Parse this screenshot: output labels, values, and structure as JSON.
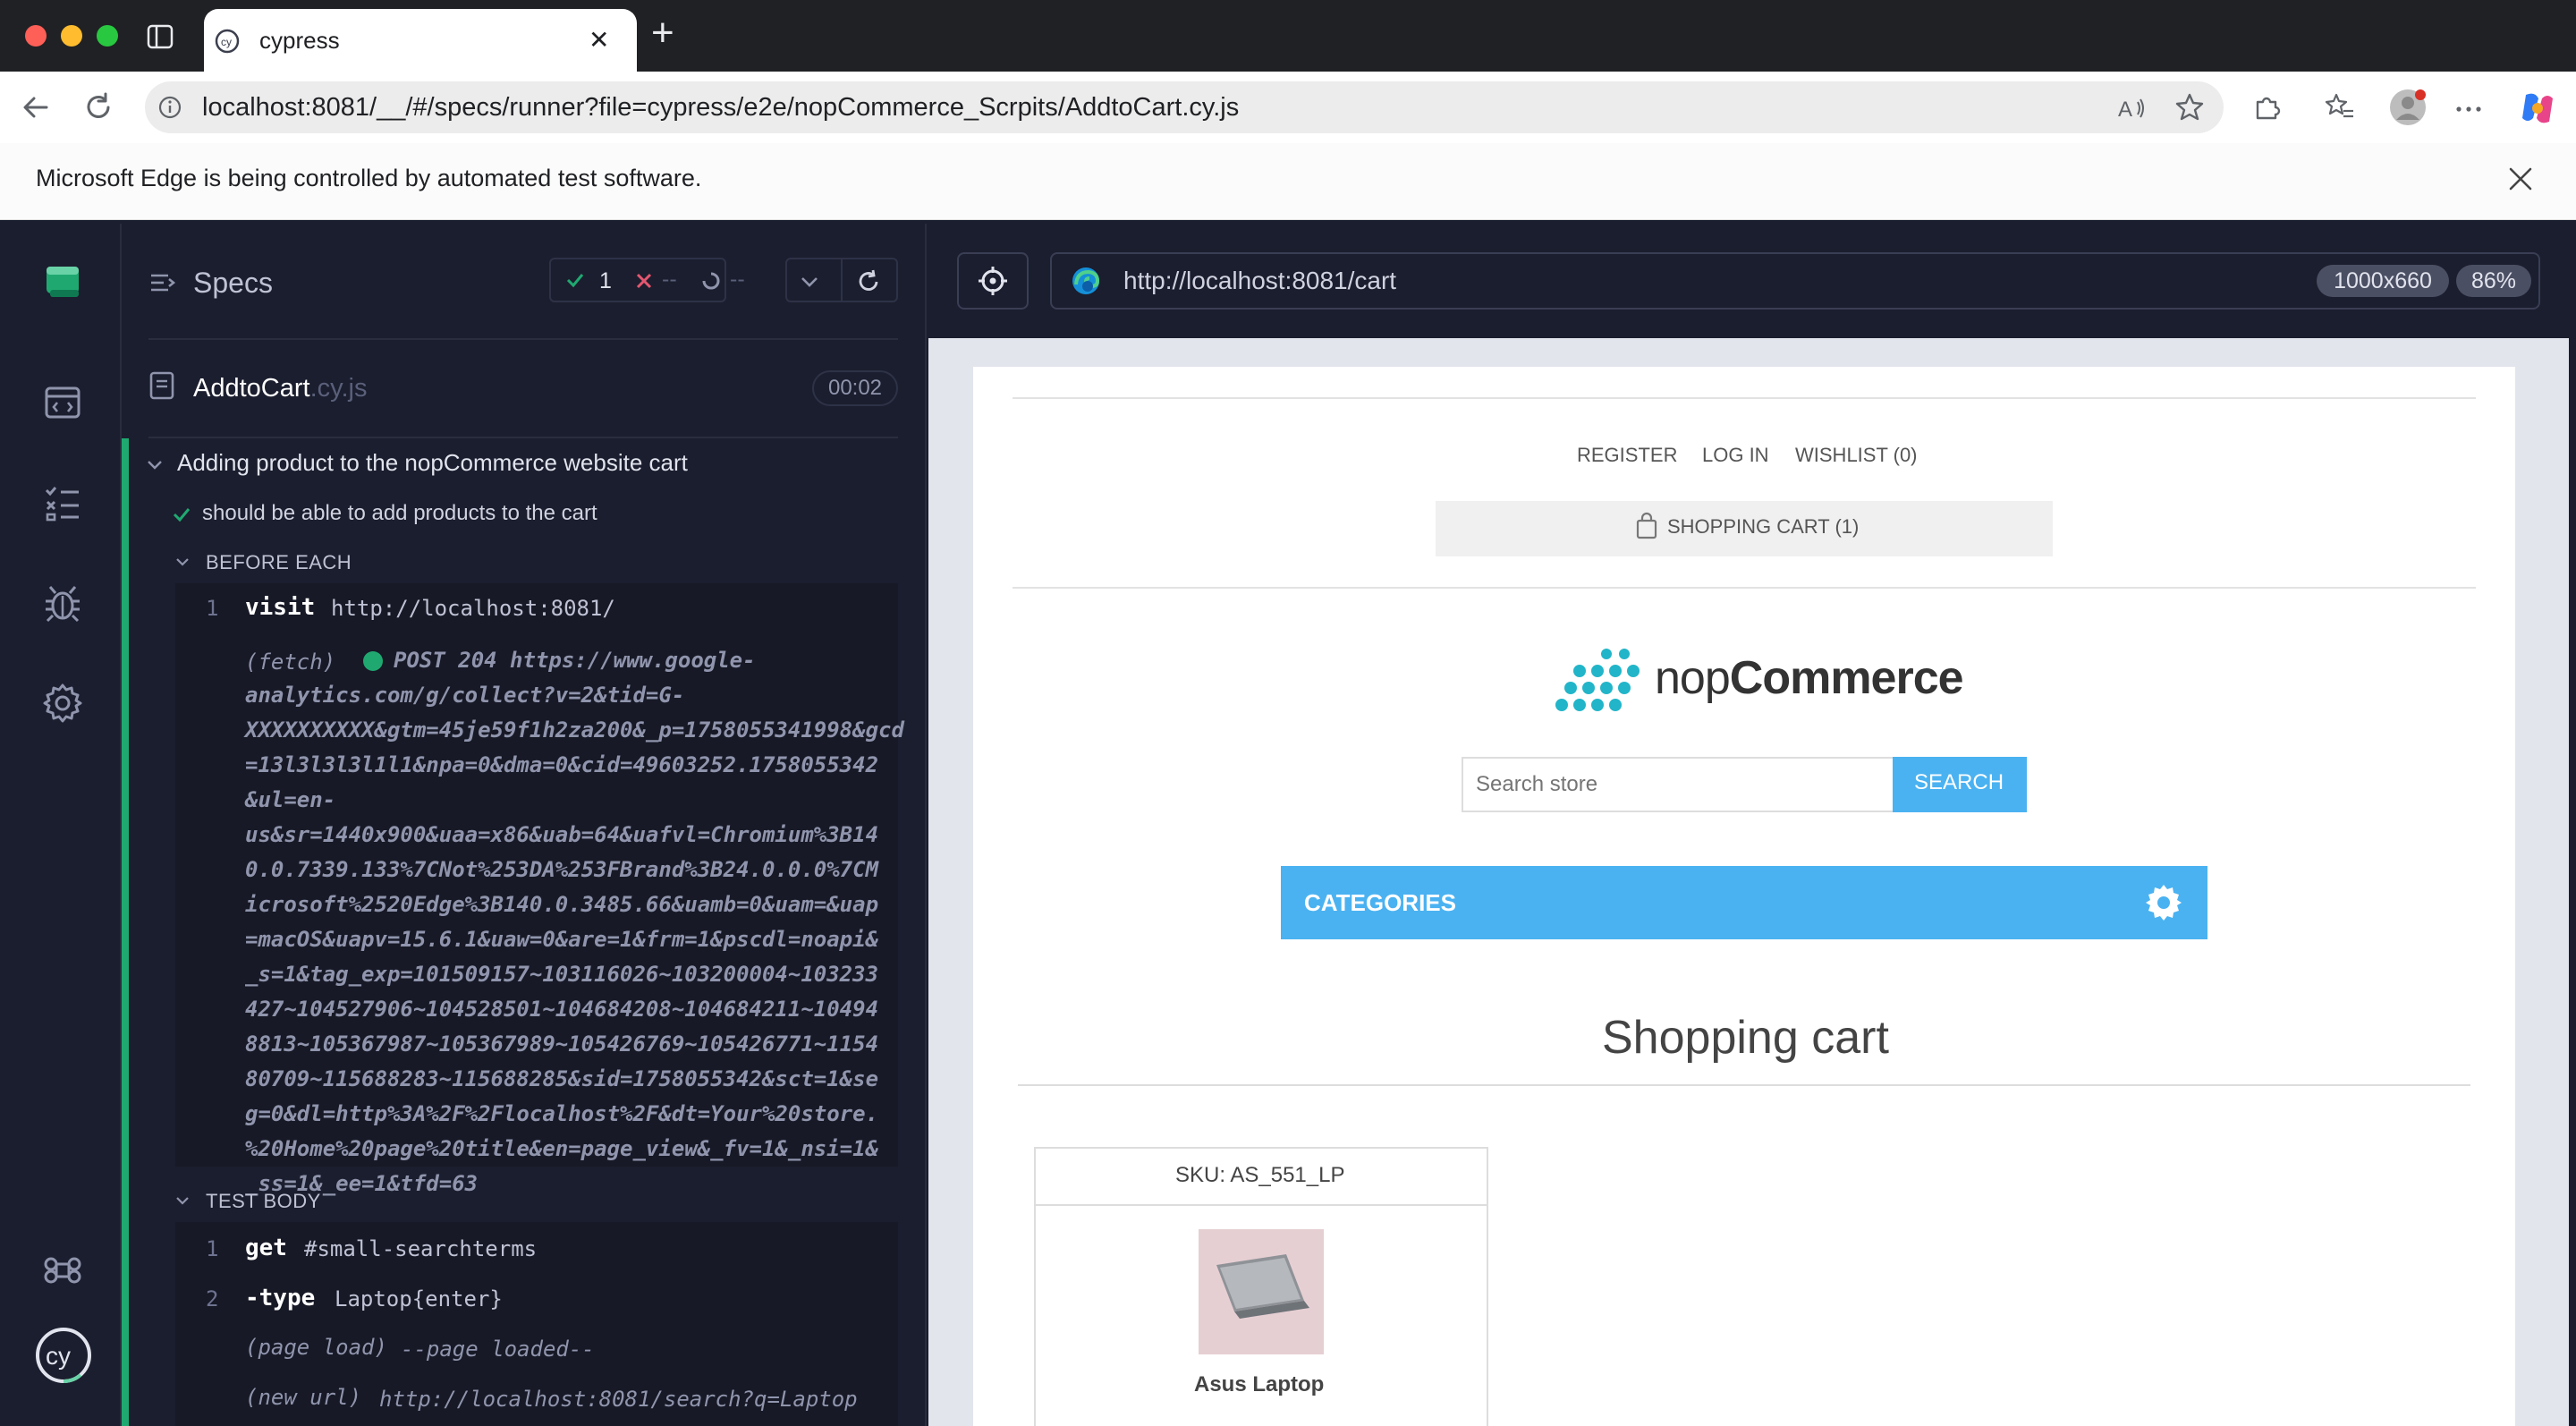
{
  "browser": {
    "tab_title": "cypress",
    "new_tab_symbol": "+",
    "close_tab_symbol": "✕",
    "url": "localhost:8081/__/#/specs/runner?file=cypress/e2e/nopCommerce_Scrpits/AddtoCart.cy.js",
    "info_message": "Microsoft Edge is being controlled by automated test software."
  },
  "sidebar": {
    "specs_label": "Specs",
    "passed_count": "1",
    "failed_count": "--",
    "pending_count": "--"
  },
  "spec": {
    "name": "AddtoCart",
    "ext": ".cy.js",
    "duration": "00:02"
  },
  "suite": {
    "title": "Adding product to the nopCommerce website cart",
    "test_title": "should be able to add products to the cart",
    "before_each_label": "BEFORE EACH",
    "test_body_label": "TEST BODY"
  },
  "commands": {
    "before": [
      {
        "num": "1",
        "name": "visit",
        "msg": "http://localhost:8081/"
      }
    ],
    "fetch_name": "(fetch)",
    "fetch_lines": [
      "POST 204 https://www.google-",
      "analytics.com/g/collect?v=2&tid=G-",
      "XXXXXXXXXX&gtm=45je59f1h2za200&_p=1758055341998&gcd",
      "=13l3l3l3l1l1&npa=0&dma=0&cid=49603252.1758055342",
      "&ul=en-",
      "us&sr=1440x900&uaa=x86&uab=64&uafvl=Chromium%3B14",
      "0.0.7339.133%7CNot%253DA%253FBrand%3B24.0.0.0%7CM",
      "icrosoft%2520Edge%3B140.0.3485.66&uamb=0&uam=&uap",
      "=macOS&uapv=15.6.1&uaw=0&are=1&frm=1&pscdl=noapi&",
      "_s=1&tag_exp=101509157~103116026~103200004~103233",
      "427~104527906~104528501~104684208~104684211~10494",
      "8813~105367987~105367989~105426769~105426771~1154",
      "80709~115688283~115688285&sid=1758055342&sct=1&se",
      "g=0&dl=http%3A%2F%2Flocalhost%2F&dt=Your%20store.",
      "%20Home%20page%20title&en=page_view&_fv=1&_nsi=1&",
      "_ss=1&_ee=1&tfd=63"
    ],
    "body": [
      {
        "num": "1",
        "name": "get",
        "msg": "#small-searchterms"
      },
      {
        "num": "2",
        "name": "-type",
        "msg": "Laptop{enter}"
      },
      {
        "num": "",
        "name": "(page load)",
        "msg": "--page loaded--"
      },
      {
        "num": "",
        "name": "(new url)",
        "msg": "http://localhost:8081/search?q=Laptop"
      }
    ]
  },
  "aut": {
    "url": "http://localhost:8081/cart",
    "viewport": "1000x660",
    "scale": "86%",
    "header_links": [
      "REGISTER",
      "LOG IN",
      "WISHLIST (0)"
    ],
    "cart_link": "SHOPPING CART (1)",
    "logo_text_light": "nop",
    "logo_text_bold": "Commerce",
    "search_placeholder": "Search store",
    "search_button": "SEARCH",
    "categories_label": "CATEGORIES",
    "page_title": "Shopping cart",
    "sku": "SKU: AS_551_LP",
    "product_name": "Asus Laptop"
  },
  "colors": {
    "cypress_green": "#1fa971",
    "fail_red": "#e45770",
    "nop_blue": "#4ab2f1",
    "runner_bg": "#1b1e2e"
  },
  "icons": [
    "sidebar-icon",
    "cypress-tab-icon",
    "back-icon",
    "reload-icon",
    "info-icon",
    "read-aloud-icon",
    "favorite-icon",
    "extensions-icon",
    "favorites-icon",
    "profile-icon",
    "more-icon",
    "copilot-icon",
    "close-icon",
    "specs-icon",
    "runs-icon",
    "debug-icon",
    "settings-icon",
    "command-icon",
    "cypress-logo-icon",
    "selector-playground-icon",
    "edge-icon",
    "bag-icon",
    "gear-icon",
    "chevron-down-icon"
  ]
}
